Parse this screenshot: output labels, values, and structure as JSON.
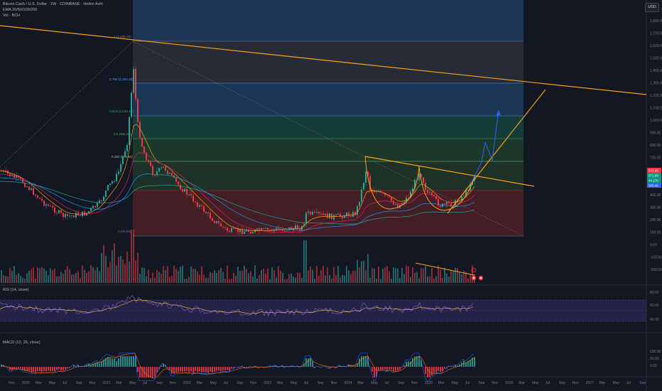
{
  "header": {
    "title": "Bitcoin Cash / U.S. Dollar · 1W · COINBASE · Heikin Ashi",
    "ema_label": "EMA 20/50/100/200",
    "vol_label": "Vol · BCH",
    "currency_button": "USD"
  },
  "panes": {
    "rsi_label": "RSI (14, close)",
    "macd_label": "MACD (12, 26, close)"
  },
  "price_axis": [
    "1,800.00",
    "1,700.00",
    "1,600.00",
    "1,500.00",
    "1,400.00",
    "1,300.00",
    "1,200.00",
    "1,100.00",
    "1,000.00",
    "900.00",
    "800.00",
    "700.00",
    "600.00",
    "500.00",
    "400.00",
    "300.00",
    "200.00",
    "100.00",
    "0.00",
    "-100.00",
    "-200.00"
  ],
  "rsi_axis": [
    "80.00",
    "60.00",
    "40.00"
  ],
  "macd_axis": [
    "100.00",
    "50.00",
    "0.00"
  ],
  "time_axis": [
    "Nov",
    "2020",
    "Mar",
    "May",
    "Jul",
    "Sep",
    "Nov",
    "2021",
    "Mar",
    "May",
    "Jul",
    "Sep",
    "Nov",
    "2022",
    "Mar",
    "May",
    "Jul",
    "Sep",
    "Nov",
    "2023",
    "Mar",
    "May",
    "Jul",
    "Sep",
    "Nov",
    "2024",
    "Mar",
    "May",
    "Jul",
    "Sep",
    "Nov",
    "2025",
    "Mar",
    "May",
    "Jul",
    "Sep",
    "Nov",
    "2026",
    "Mar",
    "May",
    "Jul",
    "Sep",
    "Nov",
    "2027",
    "Mar",
    "May",
    "Jul",
    "Sep"
  ],
  "fib_levels": [
    {
      "label": "1 (1,635.20)",
      "color": "#787b86"
    },
    {
      "label": "0.786 (1,304.20)",
      "color": "#5b9cf6"
    },
    {
      "label": "0.618 (1,044.40)",
      "color": "#26a69a"
    },
    {
      "label": "0.5 (961.93)",
      "color": "#4caf50"
    },
    {
      "label": "0.382 (679.84)",
      "color": "#81c784"
    },
    {
      "label": "0 (93.00)",
      "color": "#787b86"
    }
  ],
  "price_tags": [
    {
      "text": "571.00",
      "color": "#f23645"
    },
    {
      "text": "571.99",
      "color": "#089981"
    },
    {
      "text": "44.17K",
      "color": "#089981"
    },
    {
      "text": "505.45",
      "color": "#2962ff"
    }
  ],
  "annotation_marker": "f",
  "colors": {
    "up": "#26a69a",
    "down": "#f23645",
    "trendline": "#f7a21b",
    "projection": "#2962ff",
    "rsi": "#7e57c2",
    "background": "#131722"
  }
}
